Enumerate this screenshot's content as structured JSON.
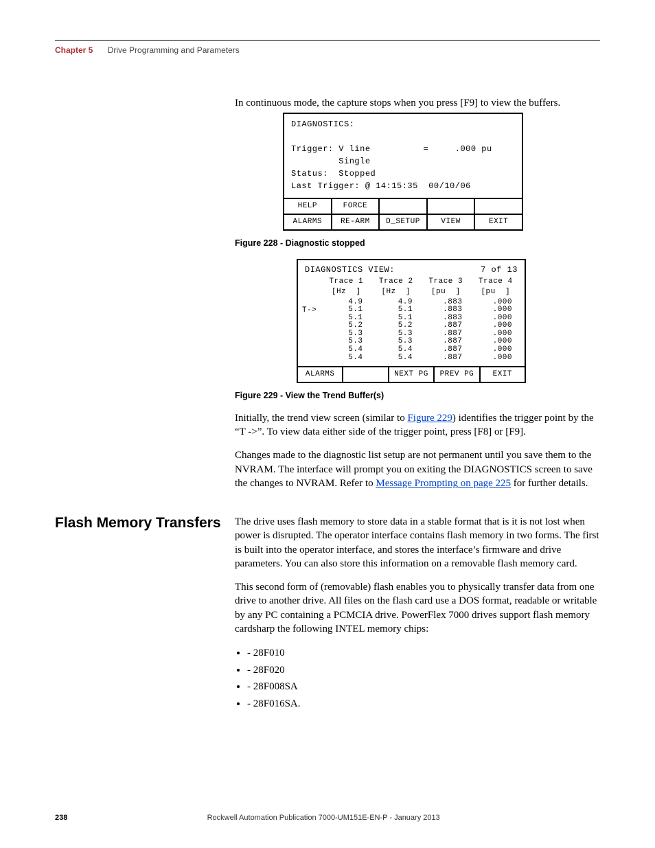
{
  "header": {
    "chapter": "Chapter 5",
    "title": "Drive Programming and Parameters"
  },
  "intro_para": "In continuous mode, the capture stops when you press [F9] to view the buffers.",
  "screen1": {
    "title": "DIAGNOSTICS:",
    "lines": "Trigger: V line          =     .000 pu\n         Single\nStatus:  Stopped\nLast Trigger: @ 14:15:35  00/10/06",
    "row1": [
      "HELP",
      "FORCE",
      "",
      "",
      ""
    ],
    "row2": [
      "ALARMS",
      "RE-ARM",
      "D_SETUP",
      "VIEW",
      "EXIT"
    ]
  },
  "fig228": "Figure 228 - Diagnostic stopped",
  "screen2": {
    "title_left": "DIAGNOSTICS VIEW:",
    "title_right": "7 of 13",
    "traces": [
      {
        "name": "Trace 1",
        "unit": "[Hz  ]",
        "vals": [
          "4.9",
          "5.1",
          "5.1",
          "5.2",
          "5.3",
          "5.3",
          "5.4",
          "5.4"
        ]
      },
      {
        "name": "Trace 2",
        "unit": "[Hz  ]",
        "vals": [
          "4.9",
          "5.1",
          "5.1",
          "5.2",
          "5.3",
          "5.3",
          "5.4",
          "5.4"
        ]
      },
      {
        "name": "Trace 3",
        "unit": "[pu  ]",
        "vals": [
          ".883",
          ".883",
          ".883",
          ".887",
          ".887",
          ".887",
          ".887",
          ".887"
        ]
      },
      {
        "name": "Trace 4",
        "unit": "[pu  ]",
        "vals": [
          ".000",
          ".000",
          ".000",
          ".000",
          ".000",
          ".000",
          ".000",
          ".000"
        ]
      }
    ],
    "marker": "T->",
    "row": [
      "ALARMS",
      "",
      "NEXT PG",
      "PREV PG",
      "EXIT"
    ]
  },
  "fig229": "Figure 229 - View the Trend Buffer(s)",
  "para_after_fig229_a": "Initially, the trend view screen (similar to ",
  "fig229_link": "Figure 229",
  "para_after_fig229_b": ") identifies the trigger point by the “T ->”. To view data either side of the trigger point, press [F8] or [F9].",
  "para_nvram_a": "Changes made to the diagnostic list setup are not permanent until you save them to the NVRAM. The interface will prompt you on exiting the DIAGNOSTICS screen to save the changes to NVRAM. Refer to ",
  "link2_text": "Message Prompting",
  "link2_page": " on page 225",
  "para_nvram_b": " for further details.",
  "section_heading": "Flash Memory Transfers",
  "flash_para1": "The drive uses flash memory to store data in a stable format that is it is not lost when power is disrupted. The operator interface contains flash memory in two forms. The first is built into the operator interface, and stores the interface’s firmware and drive parameters. You can also store this information on a removable flash memory card.",
  "flash_para2": "This second form of (removable) flash enables you to physically transfer data from one drive to another drive. All files on the flash card use a DOS format, readable or writable by any PC containing a PCMCIA drive. PowerFlex 7000 drives support flash memory cardsharp the following INTEL memory chips:",
  "chips": [
    "- 28F010",
    "- 28F020",
    "- 28F008SA",
    "- 28F016SA."
  ],
  "footer": {
    "page": "238",
    "pub": "Rockwell Automation Publication 7000-UM151E-EN-P - January 2013"
  }
}
